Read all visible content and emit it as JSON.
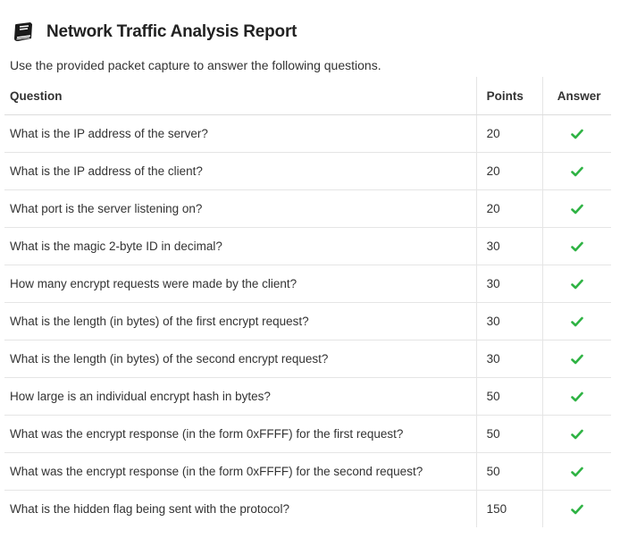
{
  "header": {
    "icon": "book-icon",
    "title": "Network Traffic Analysis Report"
  },
  "subtitle": "Use the provided packet capture to answer the following questions.",
  "table": {
    "columns": {
      "question": "Question",
      "points": "Points",
      "answer": "Answer"
    },
    "rows": [
      {
        "question": "What is the IP address of the server?",
        "points": "20",
        "answer": "check-icon"
      },
      {
        "question": "What is the IP address of the client?",
        "points": "20",
        "answer": "check-icon"
      },
      {
        "question": "What port is the server listening on?",
        "points": "20",
        "answer": "check-icon"
      },
      {
        "question": "What is the magic 2-byte ID in decimal?",
        "points": "30",
        "answer": "check-icon"
      },
      {
        "question": "How many encrypt requests were made by the client?",
        "points": "30",
        "answer": "check-icon"
      },
      {
        "question": "What is the length (in bytes) of the first encrypt request?",
        "points": "30",
        "answer": "check-icon"
      },
      {
        "question": "What is the length (in bytes) of the second encrypt request?",
        "points": "30",
        "answer": "check-icon"
      },
      {
        "question": "How large is an individual encrypt hash in bytes?",
        "points": "50",
        "answer": "check-icon"
      },
      {
        "question": "What was the encrypt response (in the form 0xFFFF) for the first request?",
        "points": "50",
        "answer": "check-icon"
      },
      {
        "question": "What was the encrypt response (in the form 0xFFFF) for the second request?",
        "points": "50",
        "answer": "check-icon"
      },
      {
        "question": "What is the hidden flag being sent with the protocol?",
        "points": "150",
        "answer": "check-icon"
      }
    ]
  },
  "colors": {
    "check": "#2fb344",
    "text": "#333333",
    "icon": "#1a1a1a"
  }
}
